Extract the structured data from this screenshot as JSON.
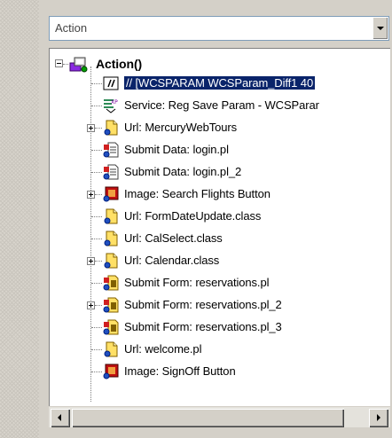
{
  "dropdown": {
    "selected": "Action"
  },
  "tree": {
    "root": {
      "label": "Action()"
    },
    "items": [
      {
        "label": "// [WCSPARAM WCSParam_Diff1 40",
        "icon": "comment-icon",
        "expandable": false,
        "selected": true
      },
      {
        "label": "Service: Reg Save Param - WCSParar",
        "icon": "service-xml-icon",
        "expandable": false,
        "selected": false
      },
      {
        "label": "Url: MercuryWebTours",
        "icon": "url-icon",
        "expandable": true,
        "selected": false
      },
      {
        "label": "Submit Data: login.pl",
        "icon": "submit-data-icon",
        "expandable": false,
        "selected": false
      },
      {
        "label": "Submit Data: login.pl_2",
        "icon": "submit-data-icon",
        "expandable": false,
        "selected": false
      },
      {
        "label": "Image: Search Flights Button",
        "icon": "image-icon",
        "expandable": true,
        "selected": false
      },
      {
        "label": "Url: FormDateUpdate.class",
        "icon": "url-icon",
        "expandable": false,
        "selected": false
      },
      {
        "label": "Url: CalSelect.class",
        "icon": "url-icon",
        "expandable": false,
        "selected": false
      },
      {
        "label": "Url: Calendar.class",
        "icon": "url-icon",
        "expandable": true,
        "selected": false
      },
      {
        "label": "Submit Form: reservations.pl",
        "icon": "submit-form-icon",
        "expandable": false,
        "selected": false
      },
      {
        "label": "Submit Form: reservations.pl_2",
        "icon": "submit-form-icon",
        "expandable": true,
        "selected": false
      },
      {
        "label": "Submit Form: reservations.pl_3",
        "icon": "submit-form-icon",
        "expandable": false,
        "selected": false
      },
      {
        "label": "Url: welcome.pl",
        "icon": "url-icon",
        "expandable": false,
        "selected": false
      },
      {
        "label": "Image: SignOff Button",
        "icon": "image-icon",
        "expandable": false,
        "selected": false
      }
    ]
  },
  "colors": {
    "selection": "#0a246a",
    "panel": "#d4d0c8",
    "border": "#7f9db9"
  }
}
